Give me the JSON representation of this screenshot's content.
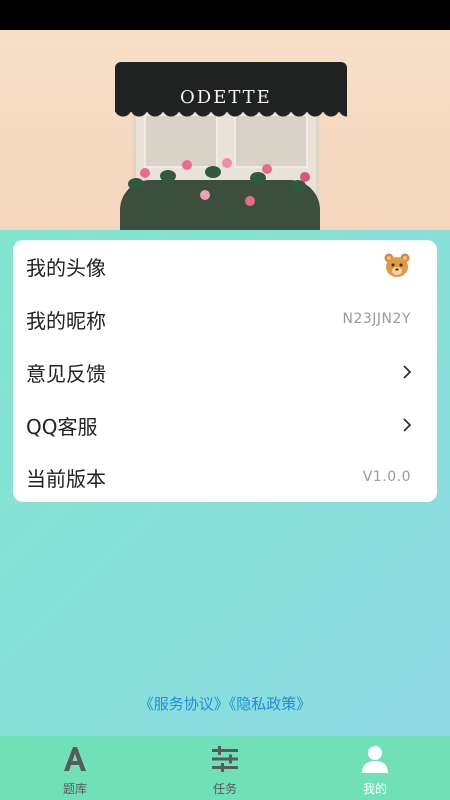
{
  "hero": {
    "sign_text": "ODETTE"
  },
  "settings": [
    {
      "label": "我的头像",
      "value": "",
      "trailing": "bear-avatar-icon"
    },
    {
      "label": "我的昵称",
      "value": "N23JJN2Y",
      "trailing": "text"
    },
    {
      "label": "意见反馈",
      "value": "",
      "trailing": "chevron-right-icon"
    },
    {
      "label": "QQ客服",
      "value": "",
      "trailing": "chevron-right-icon"
    },
    {
      "label": "当前版本",
      "value": "V1.0.0",
      "trailing": "text"
    }
  ],
  "links": {
    "service": "《服务协议》",
    "privacy": "《隐私政策》"
  },
  "nav": [
    {
      "label": "题库",
      "icon": "letter-a-icon",
      "active": false
    },
    {
      "label": "任务",
      "icon": "sliders-icon",
      "active": false
    },
    {
      "label": "我的",
      "icon": "person-icon",
      "active": true
    }
  ],
  "colors": {
    "link": "#1f8fd8",
    "nav_bg": "#6fe0b8",
    "gradient_start": "#7fe9c8",
    "gradient_end": "#8fd8e6"
  }
}
